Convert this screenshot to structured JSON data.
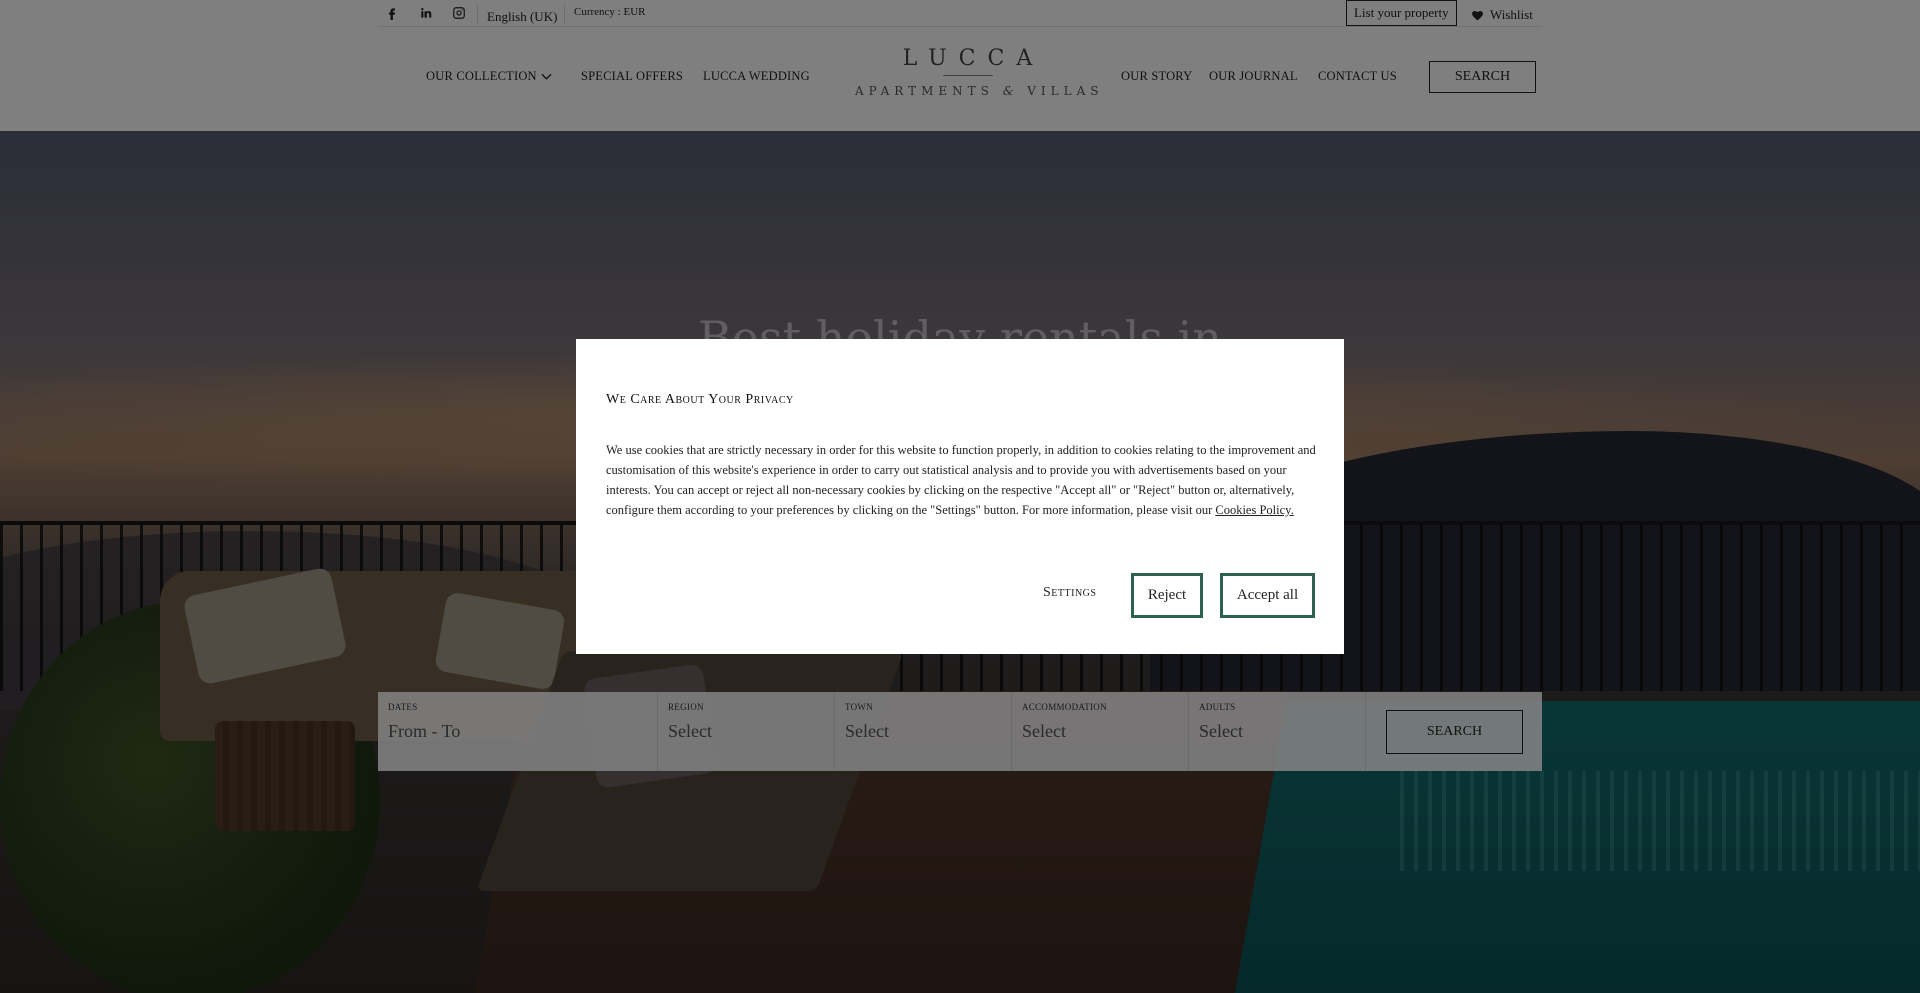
{
  "topbar": {
    "social": [
      "facebook-icon",
      "linkedin-icon",
      "instagram-icon"
    ],
    "language": "English (UK)",
    "currency": "Currency : EUR",
    "list_property": "List your property",
    "wishlist": "Wishlist"
  },
  "nav": {
    "left": [
      "OUR COLLECTION",
      "SPECIAL OFFERS",
      "LUCCA WEDDING"
    ],
    "right": [
      "OUR STORY",
      "OUR JOURNAL",
      "CONTACT US"
    ],
    "search": "SEARCH"
  },
  "logo": {
    "top": "LUCCA",
    "bottom_left": "APARTMENTS",
    "amp": "&",
    "bottom_right": "VILLAS"
  },
  "hero": {
    "title_partial": "Best holiday rentals in"
  },
  "search": {
    "fields": [
      {
        "label": "DATES",
        "value": "From - To"
      },
      {
        "label": "REGION",
        "value": "Select"
      },
      {
        "label": "TOWN",
        "value": "Select"
      },
      {
        "label": "ACCOMMODATION",
        "value": "Select"
      },
      {
        "label": "ADULTS",
        "value": "Select"
      }
    ],
    "button": "SEARCH"
  },
  "cookie": {
    "title": "We Care About Your Privacy",
    "body": "We use cookies that are strictly necessary in order for this website to function properly, in addition to cookies relating to the improvement and customisation of this website's experience in order to carry out statistical analysis and to provide you with advertisements based on your interests. You can accept or reject all non-necessary cookies by clicking on the respective \"Accept all\" or \"Reject\" button or, alternatively, configure them according to your preferences by clicking on the \"Settings\" button. For more information, please visit our ",
    "policy_link": "Cookies Policy.",
    "settings": "Settings",
    "reject": "Reject",
    "accept": "Accept all",
    "accent_color": "#2e6250"
  }
}
